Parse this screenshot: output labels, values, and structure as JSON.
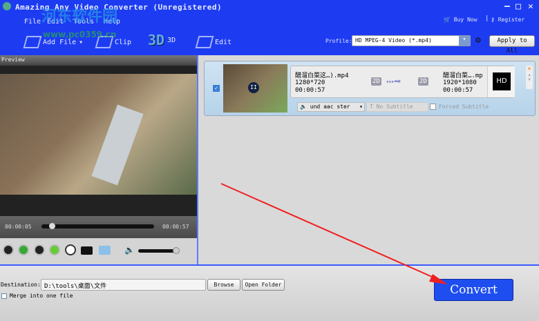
{
  "window": {
    "title": "Amazing Any Video Converter (Unregistered)",
    "minimize": "—",
    "maximize": "□",
    "close": "✕"
  },
  "menu": [
    "File",
    "Edit",
    "Tools",
    "Help"
  ],
  "toolbar": {
    "add_file": "Add File",
    "clip": "Clip",
    "three_d_icon": "3D",
    "three_d": "3D",
    "edit": "Edit"
  },
  "header_links": {
    "buy_now": "Buy Now",
    "register": "Register"
  },
  "profile": {
    "label": "Profile:",
    "value": "HD MPEG-4 Video (*.mp4)",
    "apply_all": "Apply to All"
  },
  "preview": {
    "label": "Preview",
    "current_time": "00:00:05",
    "total_time": "00:00:57",
    "progress": 0.09,
    "volume": 0.95
  },
  "file_item": {
    "checked": true,
    "source": {
      "name": "醋溜白菜这…).mp4",
      "resolution": "1280*720",
      "duration": "00:00:57",
      "mode": "2D"
    },
    "target": {
      "name": "醋溜白菜….mp",
      "resolution": "1920*1080",
      "duration": "00:00:57",
      "mode": "2D"
    },
    "badge": "HD",
    "audio": "und aac ster",
    "subtitle": "No Subtitle",
    "forced_subtitle": "Forced Subtitle"
  },
  "destination": {
    "label": "Destination:",
    "value": "D:\\tools\\桌面\\文件",
    "browse": "Browse",
    "open_folder": "Open Folder",
    "merge": "Merge into one file"
  },
  "convert": "Convert",
  "watermark": {
    "name": "河东软件园",
    "url": "www.pc0359.cn"
  },
  "colors": {
    "header": "#1d3cf2",
    "convert": "#1e4ef0",
    "arrow": "#f02020"
  }
}
